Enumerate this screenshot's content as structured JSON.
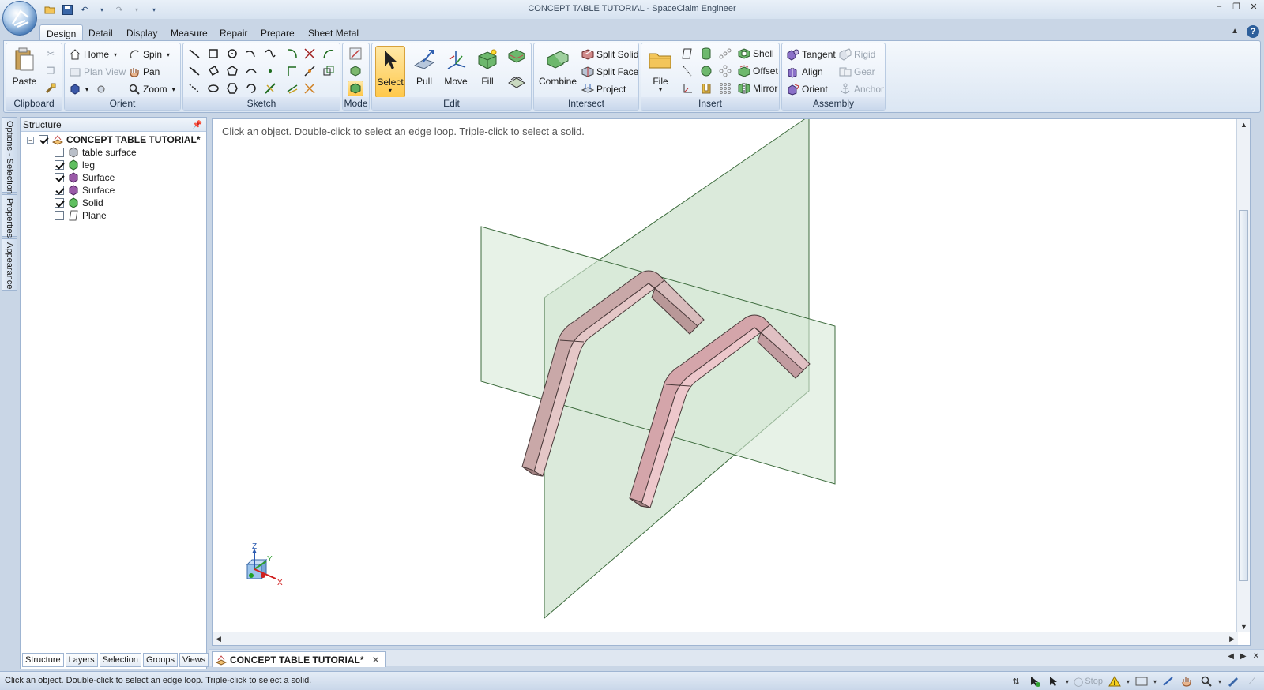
{
  "window": {
    "title": "CONCEPT TABLE TUTORIAL - SpaceClaim Engineer"
  },
  "ribbon_tabs": [
    "Design",
    "Detail",
    "Display",
    "Measure",
    "Repair",
    "Prepare",
    "Sheet Metal"
  ],
  "active_tab": "Design",
  "ribbon": {
    "clipboard": {
      "label": "Clipboard",
      "paste": "Paste"
    },
    "orient": {
      "label": "Orient",
      "home": "Home",
      "spin": "Spin",
      "plan_view": "Plan View",
      "pan": "Pan",
      "zoom": "Zoom"
    },
    "sketch": {
      "label": "Sketch"
    },
    "mode": {
      "label": "Mode"
    },
    "edit": {
      "label": "Edit",
      "select": "Select",
      "pull": "Pull",
      "move": "Move",
      "fill": "Fill"
    },
    "intersect": {
      "label": "Intersect",
      "combine": "Combine",
      "split_solid": "Split Solid",
      "split_face": "Split Face",
      "project": "Project"
    },
    "insert": {
      "label": "Insert",
      "file": "File",
      "shell": "Shell",
      "offset": "Offset",
      "mirror": "Mirror"
    },
    "assembly": {
      "label": "Assembly",
      "tangent": "Tangent",
      "align": "Align",
      "orient": "Orient",
      "rigid": "Rigid",
      "gear": "Gear",
      "anchor": "Anchor"
    }
  },
  "side_tabs": [
    "Options - Selection",
    "Properties",
    "Appearance"
  ],
  "structure": {
    "header": "Structure",
    "root": "CONCEPT TABLE TUTORIAL*",
    "items": [
      {
        "label": "table surface",
        "checked": false,
        "icon": "solid-gray-icon"
      },
      {
        "label": "leg",
        "checked": true,
        "icon": "solid-green-icon"
      },
      {
        "label": "Surface",
        "checked": true,
        "icon": "surface-purple-icon"
      },
      {
        "label": "Surface",
        "checked": true,
        "icon": "surface-purple-icon"
      },
      {
        "label": "Solid",
        "checked": true,
        "icon": "solid-green-icon"
      },
      {
        "label": "Plane",
        "checked": false,
        "icon": "plane-icon"
      }
    ],
    "tabs": [
      "Structure",
      "Layers",
      "Selection",
      "Groups",
      "Views"
    ],
    "active_tab": "Structure"
  },
  "viewport": {
    "hint": "Click an object. Double-click to select an edge loop. Triple-click to select a solid.",
    "axis_labels": {
      "x": "X",
      "y": "Y",
      "z": "Z"
    }
  },
  "document_tab": "CONCEPT TABLE TUTORIAL*",
  "status": {
    "text": "Click an object. Double-click to select an edge loop. Triple-click to select a solid.",
    "stop": "Stop"
  },
  "colors": {
    "plane_fill": "#cfe3cf",
    "plane_edge": "#3c6b3c",
    "leg_fill": "#c9a8a8",
    "accent": "#ffc84a"
  }
}
